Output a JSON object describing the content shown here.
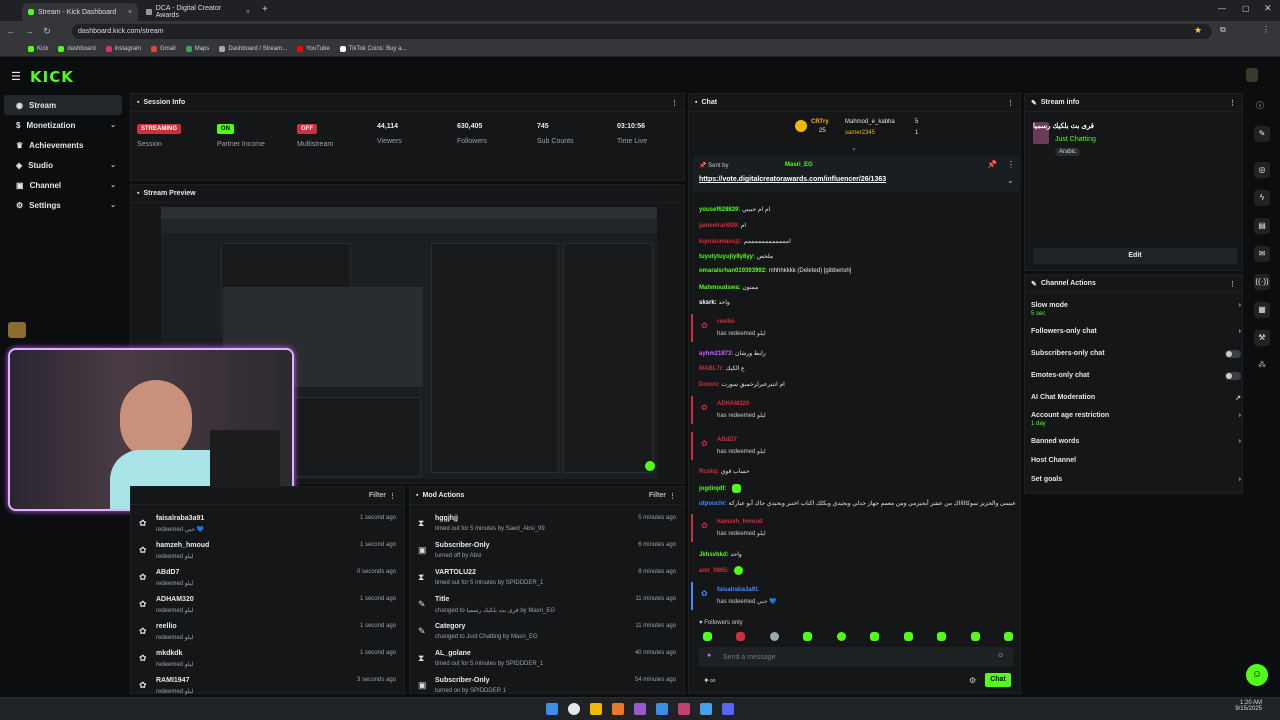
{
  "browser": {
    "tabs": [
      {
        "label": "Stream - Kick Dashboard",
        "active": true
      },
      {
        "label": "DCA - Digital Creator Awards",
        "active": false
      }
    ],
    "url": "dashboard.kick.com/stream",
    "bookmarks": [
      "Kick",
      "dashboard",
      "instagram",
      "Gmail",
      "Maps",
      "Dashboard / Stream...",
      "YouTube",
      "TikTok Coins: Buy a..."
    ]
  },
  "brand": {
    "logo": "KICK",
    "accent": "#53fc18"
  },
  "sidebar": {
    "items": [
      {
        "label": "Stream",
        "icon": "stream-icon",
        "active": true
      },
      {
        "label": "Monetization",
        "icon": "dollar-icon",
        "chevron": true
      },
      {
        "label": "Achievements",
        "icon": "trophy-icon"
      },
      {
        "label": "Studio",
        "icon": "studio-icon",
        "chevron": true
      },
      {
        "label": "Channel",
        "icon": "channel-icon",
        "chevron": true
      },
      {
        "label": "Settings",
        "icon": "gear-icon",
        "chevron": true
      }
    ]
  },
  "session": {
    "title": "Session Info",
    "stats": [
      {
        "value": "STREAMING",
        "label": "Session",
        "badge": "red"
      },
      {
        "value": "ON",
        "label": "Partner Income",
        "badge": "green"
      },
      {
        "value": "OFF",
        "label": "Multistream",
        "badge": "red"
      },
      {
        "value": "44,114",
        "label": "Viewers"
      },
      {
        "value": "630,405",
        "label": "Followers"
      },
      {
        "value": "745",
        "label": "Sub Counts"
      },
      {
        "value": "03:10:56",
        "label": "Time Live"
      }
    ]
  },
  "preview": {
    "title": "Stream Preview"
  },
  "activity": {
    "filter": "Filter",
    "rows": [
      {
        "name": "faisalraba3a91",
        "sub": "redeemed حبي 💙",
        "time": "1 second ago"
      },
      {
        "name": "hamzeh_hmoud",
        "sub": "redeemed ليلو",
        "time": "1 second ago"
      },
      {
        "name": "ABdD7",
        "sub": "redeemed ليلو",
        "time": "0 seconds ago"
      },
      {
        "name": "ADHAM320",
        "sub": "redeemed ليلو",
        "time": "1 second ago"
      },
      {
        "name": "reellio",
        "sub": "redeemed ليلو",
        "time": "1 second ago"
      },
      {
        "name": "mkdkdk",
        "sub": "redeemed ليلو",
        "time": "1 second ago"
      },
      {
        "name": "RAMI1947",
        "sub": "redeemed ليلو",
        "time": "3 seconds ago"
      }
    ]
  },
  "mod_actions": {
    "title": "Mod Actions",
    "filter": "Filter",
    "rows": [
      {
        "name": "hggjhjj",
        "sub": "timed out for 5 minutes by Saed_Absi_99",
        "time": "5 minutes ago",
        "icon": "hourglass-icon"
      },
      {
        "name": "Subscriber-Only",
        "sub": "turned off by Absi",
        "time": "6 minutes ago",
        "icon": "shield-icon"
      },
      {
        "name": "VARTOLU22",
        "sub": "timed out for 5 minutes by SPIDDDER_1",
        "time": "8 minutes ago",
        "icon": "hourglass-icon"
      },
      {
        "name": "Title",
        "sub": "changed to قرى بث بلكيك رسميا by Masri_EG",
        "time": "11 minutes ago",
        "icon": "edit-icon"
      },
      {
        "name": "Category",
        "sub": "changed to Just Chatting by Masri_EG",
        "time": "11 minutes ago",
        "icon": "edit-icon"
      },
      {
        "name": "AL_golane",
        "sub": "timed out for 5 minutes by SPIDDDER_1",
        "time": "40 minutes ago",
        "icon": "hourglass-icon"
      },
      {
        "name": "Subscriber-Only",
        "sub": "turned on by SPIDDDER 1",
        "time": "54 minutes ago",
        "icon": "shield-icon"
      }
    ]
  },
  "chat": {
    "title": "Chat",
    "top_gifters": [
      {
        "name": "CR7ry",
        "count": "25"
      },
      {
        "name": "Mahmod_e_kabha",
        "count": "5"
      },
      {
        "name": "samer2345",
        "count": "1"
      }
    ],
    "pinned": {
      "sent_by": "Sent by",
      "user": "Masri_EG",
      "link": "https://vote.digitalcreatorawards.com/influencer/26/1363"
    },
    "messages": [
      {
        "user": "yousef628839:",
        "text": "ام ام حبيبي",
        "color": "#53fc18"
      },
      {
        "user": "jameelrah909:",
        "text": "ام",
        "color": "#cf2f3a"
      },
      {
        "user": "kqmaismaosjz:",
        "text": "اممممممممممممم",
        "color": "#cf2f3a"
      },
      {
        "user": "tuyutytuyujiy8y8yy:",
        "text": "ملخص",
        "color": "#53fc18"
      },
      {
        "user": "omaralsrhan019393992:",
        "text": "mhhhkkkk (Deleted) [gibberish]",
        "color": "#53fc18"
      },
      {
        "user": "Mahmoudswa:",
        "text": "ممنون",
        "color": "#53fc18"
      },
      {
        "user": "sksrk:",
        "text": "واحد",
        "color": "#fff"
      }
    ],
    "redeems": [
      {
        "user": "reellio",
        "text": "has redeemed ليلو"
      },
      {
        "user": "ADHAM320",
        "text": "has redeemed ليلو"
      },
      {
        "user": "ABdD7",
        "text": "has redeemed ليلو"
      },
      {
        "user": "hamzeh_hmoud",
        "text": "has redeemed ليلو"
      },
      {
        "user": "faisalraba3a91",
        "text": "has redeemed حبي 💙"
      }
    ],
    "messages2": [
      {
        "user": "ayhm21873:",
        "text": "رابط ورشان",
        "color": "#cf60ff"
      },
      {
        "user": "MABL7r:",
        "text": "ع الكيك",
        "color": "#cf2f3a"
      },
      {
        "user": "Doovu:",
        "text": "ام انتبرعبرلرخمبق سورت",
        "color": "#cf2f3a"
      },
      {
        "user": "Rcskq:",
        "text": "حساب قوي",
        "color": "#cf2f3a"
      },
      {
        "user": "jogdiojdf:",
        "text": "",
        "color": "#53fc18"
      },
      {
        "user": "utpouchr:",
        "text": "عيسى والحزيز سوكاااااك من عشر أبجيزمي ومن معمم جهاز جدلي وبجيدي وبكلك اكتاب اختبر وبحيدي جاك أبو عباركة",
        "color": "#3c8cff"
      },
      {
        "user": "Jkhsvbkd:",
        "text": "واحد",
        "color": "#53fc18"
      },
      {
        "user": "amr_0865:",
        "text": "",
        "color": "#cf2f3a"
      }
    ],
    "followers_only": "Followers only",
    "placeholder": "Send a message",
    "send": "Chat"
  },
  "stream_info": {
    "title": "Stream info",
    "stream_title": "قرى بث بلكيك رسميا",
    "category": "Just Chatting",
    "language": "Arabic",
    "edit": "Edit"
  },
  "channel_actions": {
    "title": "Channel Actions",
    "items": [
      {
        "label": "Slow mode",
        "sub": "5 sec",
        "control": "chevron"
      },
      {
        "label": "Followers-only chat",
        "control": "chevron"
      },
      {
        "label": "Subscribers-only chat",
        "control": "toggle"
      },
      {
        "label": "Emotes-only chat",
        "control": "toggle"
      },
      {
        "label": "AI Chat Moderation",
        "control": "external"
      },
      {
        "label": "Account age restriction",
        "sub": "1 day",
        "control": "chevron"
      },
      {
        "label": "Banned words",
        "control": "chevron"
      },
      {
        "label": "Host Channel",
        "control": "none"
      },
      {
        "label": "Set goals",
        "control": "chevron"
      }
    ]
  },
  "taskbar": {
    "time": "1:20 AM",
    "date": "9/15/2025"
  }
}
